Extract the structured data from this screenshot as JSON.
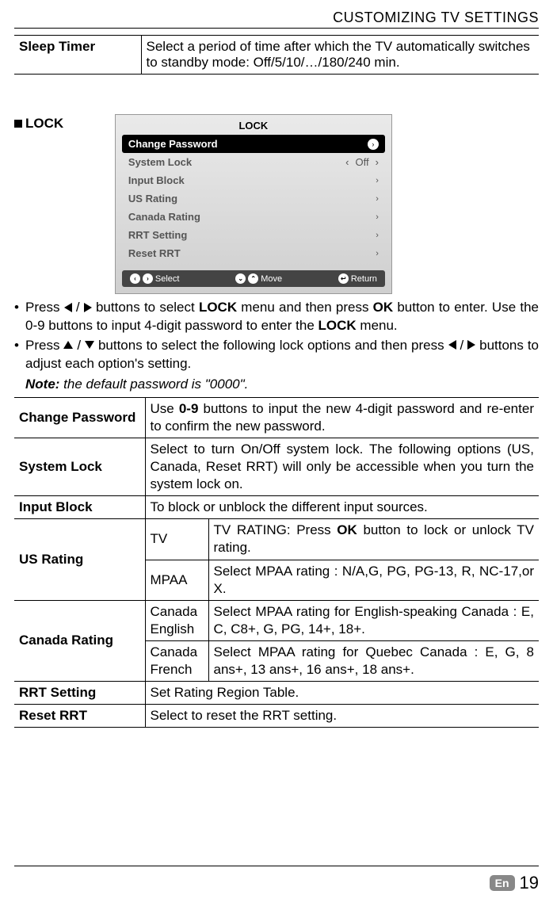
{
  "page_header": "CUSTOMIZING TV SETTINGS",
  "sleep_timer": {
    "label": "Sleep Timer",
    "desc": "Select a period of time after which the TV automatically switches to standby mode: Off/5/10/…/180/240 min."
  },
  "lock_heading": "LOCK",
  "osd": {
    "title": "LOCK",
    "rows": [
      {
        "label": "Change Password",
        "value": "",
        "active": true
      },
      {
        "label": "System Lock",
        "value": "Off",
        "active": false
      },
      {
        "label": "Input Block",
        "value": "",
        "active": false
      },
      {
        "label": "US Rating",
        "value": "",
        "active": false
      },
      {
        "label": "Canada Rating",
        "value": "",
        "active": false
      },
      {
        "label": "RRT Setting",
        "value": "",
        "active": false
      },
      {
        "label": "Reset RRT",
        "value": "",
        "active": false
      }
    ],
    "footer": {
      "select": "Select",
      "move": "Move",
      "return": "Return"
    }
  },
  "instr": {
    "i1a": "Press ",
    "i1b": " buttons to select ",
    "i1c": "LOCK",
    "i1d": " menu and then press ",
    "i1e": "OK",
    "i1f": " button to enter. Use the 0-9 buttons to input 4-digit password to enter the ",
    "i1g": "LOCK",
    "i1h": " menu.",
    "i2a": "Press ",
    "i2b": " buttons to select the following lock options and then press ",
    "i2c": " buttons to adjust each option's setting."
  },
  "note": {
    "label": "Note:",
    "text": " the default password is \"0000\"."
  },
  "table": {
    "change_password": {
      "label": "Change Password",
      "desc_a": "Use ",
      "desc_b": "0-9",
      "desc_c": " buttons to input the new 4-digit password and re-enter to confirm the new password."
    },
    "system_lock": {
      "label": "System Lock",
      "desc": "Select to turn On/Off system lock. The following options (US, Canada,  Reset RRT) will only be accessible when you turn the system lock on."
    },
    "input_block": {
      "label": "Input Block",
      "desc": "To block or unblock the different input sources."
    },
    "us_rating": {
      "label": "US Rating",
      "tv": {
        "sub": "TV",
        "desc_a": "TV RATING: Press ",
        "desc_b": "OK",
        "desc_c": " button to lock or unlock TV rating."
      },
      "mpaa": {
        "sub": "MPAA",
        "desc": "Select MPAA rating : N/A,G, PG, PG-13, R, NC-17,or X."
      }
    },
    "canada_rating": {
      "label": "Canada Rating",
      "en": {
        "sub": "Canada English",
        "desc": "Select MPAA rating for English-speaking Canada : E, C, C8+, G, PG, 14+, 18+."
      },
      "fr": {
        "sub": "Canada French",
        "desc": "Select MPAA rating for Quebec Canada : E, G, 8 ans+, 13 ans+, 16 ans+, 18 ans+."
      }
    },
    "rrt_setting": {
      "label": "RRT Setting",
      "desc": "Set Rating Region Table."
    },
    "reset_rrt": {
      "label": "Reset RRT",
      "desc": "Select to reset the RRT setting."
    }
  },
  "footer": {
    "lang": "En",
    "page": "19"
  }
}
